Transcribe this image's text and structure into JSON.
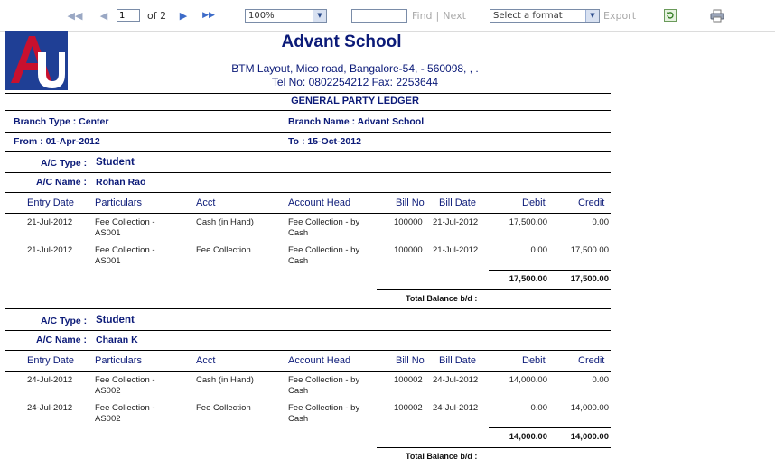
{
  "toolbar": {
    "page_value": "1",
    "page_of": "of 2",
    "zoom": "100%",
    "find_label": "Find",
    "separator": "|",
    "next_label": "Next",
    "format_select": "Select a format",
    "export_label": "Export"
  },
  "report": {
    "school_name": "Advant School",
    "address": "BTM Layout, Mico road, Bangalore-54, - 560098, , .",
    "tel": "Tel No: 0802254212 Fax: 2253644",
    "title": "GENERAL PARTY LEDGER",
    "branch_type": "Branch Type : Center",
    "branch_name": "Branch Name : Advant School",
    "from": "From : 01-Apr-2012",
    "to": "To : 15-Oct-2012",
    "columns": [
      "Entry Date",
      "Particulars",
      "Acct",
      "Account Head",
      "Bill No",
      "Bill Date",
      "Debit",
      "Credit"
    ],
    "groups": [
      {
        "ac_type_label": "A/C Type :",
        "ac_type": "Student",
        "ac_name_label": "A/C Name :",
        "ac_name": "Rohan Rao",
        "rows": [
          {
            "date": "21-Jul-2012",
            "part1": "Fee Collection -",
            "part2": "AS001",
            "acct": "Cash (in Hand)",
            "head1": "Fee Collection - by",
            "head2": "Cash",
            "billno": "100000",
            "billdate": "21-Jul-2012",
            "debit": "17,500.00",
            "credit": "0.00"
          },
          {
            "date": "21-Jul-2012",
            "part1": "Fee Collection -",
            "part2": "AS001",
            "acct": "Fee Collection",
            "head1": "Fee Collection - by",
            "head2": "Cash",
            "billno": "100000",
            "billdate": "21-Jul-2012",
            "debit": "0.00",
            "credit": "17,500.00"
          }
        ],
        "total_debit": "17,500.00",
        "total_credit": "17,500.00",
        "total_balance_label": "Total Balance b/d :"
      },
      {
        "ac_type_label": "A/C Type :",
        "ac_type": "Student",
        "ac_name_label": "A/C Name :",
        "ac_name": "Charan K",
        "rows": [
          {
            "date": "24-Jul-2012",
            "part1": "Fee Collection -",
            "part2": "AS002",
            "acct": "Cash (in Hand)",
            "head1": "Fee Collection - by",
            "head2": "Cash",
            "billno": "100002",
            "billdate": "24-Jul-2012",
            "debit": "14,000.00",
            "credit": "0.00"
          },
          {
            "date": "24-Jul-2012",
            "part1": "Fee Collection -",
            "part2": "AS002",
            "acct": "Fee Collection",
            "head1": "Fee Collection - by",
            "head2": "Cash",
            "billno": "100002",
            "billdate": "24-Jul-2012",
            "debit": "0.00",
            "credit": "14,000.00"
          }
        ],
        "total_debit": "14,000.00",
        "total_credit": "14,000.00",
        "total_balance_label": "Total Balance b/d :"
      }
    ]
  }
}
